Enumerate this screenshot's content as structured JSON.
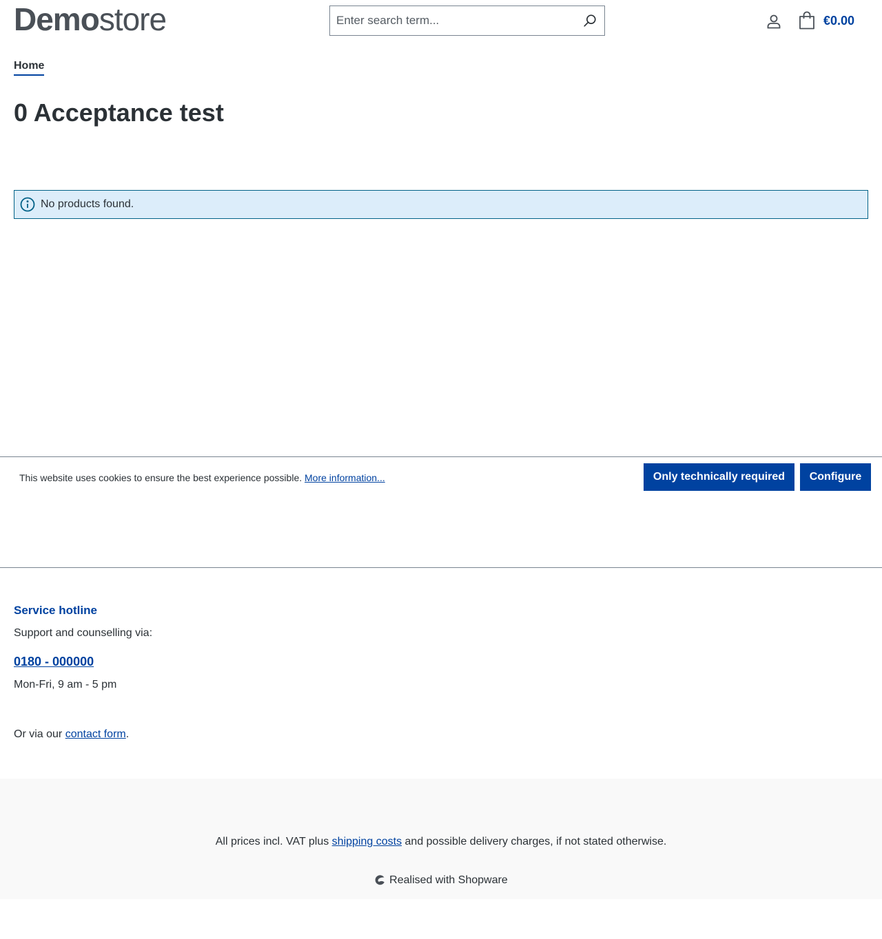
{
  "header": {
    "logo_bold": "Demo",
    "logo_light": "store",
    "search_placeholder": "Enter search term...",
    "cart_total": "€0.00"
  },
  "breadcrumb": {
    "home": "Home"
  },
  "page": {
    "title": "0 Acceptance test",
    "alert_text": "No products found."
  },
  "cookie_banner": {
    "message": "This website uses cookies to ensure the best experience possible.",
    "more_link": "More information...",
    "btn_required": "Only technically required",
    "btn_configure": "Configure"
  },
  "footer": {
    "hotline_title": "Service hotline",
    "hotline_sub": "Support and counselling via:",
    "phone": "0180 - 000000",
    "hours": "Mon-Fri, 9 am - 5 pm",
    "contact_prefix": "Or via our",
    "contact_link": "contact form",
    "contact_suffix": ".",
    "vat_prefix": "All prices incl. VAT plus",
    "vat_link": "shipping costs",
    "vat_suffix": "and possible delivery charges, if not stated otherwise.",
    "powered": "Realised with Shopware"
  },
  "colors": {
    "accent": "#0042a0",
    "text": "#2b3136",
    "alert_bg": "#dcedfa",
    "alert_border": "#006187"
  },
  "icons": [
    "search-icon",
    "user-icon",
    "bag-icon",
    "info-icon",
    "shopware-icon"
  ]
}
